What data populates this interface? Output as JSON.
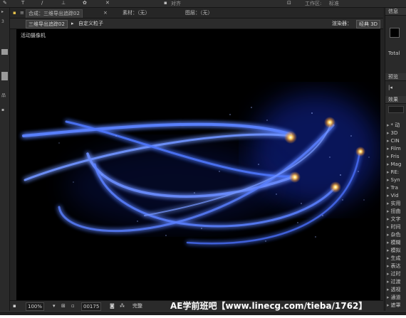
{
  "topbar": {
    "workspace_label": "工作区:",
    "workspace_value": "标准",
    "align_label": "对齐"
  },
  "tabs": [
    {
      "label": "合成：三维导出追踪02",
      "active": true
    },
    {
      "label": "素材：（无）",
      "active": false
    },
    {
      "label": "图层：（无）",
      "active": false
    }
  ],
  "subtabs": {
    "comp_chip": "三维导出追踪02",
    "custom_particle": "自定义粒子",
    "renderer_label": "渲染器：",
    "renderer_value": "经典 3D"
  },
  "viewer": {
    "camera_label": "活动摄像机",
    "background": "#000000",
    "glow_color": "#3a63ff",
    "streak_color": "#6f93ff"
  },
  "bottombar": {
    "zoom": "100%",
    "timecode": "00175",
    "quality": "完整",
    "watermark": "AE学前班吧【www.linecg.com/tieba/1762】"
  },
  "right_panel": {
    "info_header": "信息",
    "total_label": "Total",
    "preview_header": "预览",
    "effects_header": "效果",
    "effects": [
      {
        "label": "* 动"
      },
      {
        "label": "3D"
      },
      {
        "label": "CIN"
      },
      {
        "label": "Film"
      },
      {
        "label": "Fris"
      },
      {
        "label": "Mag"
      },
      {
        "label": "RE:"
      },
      {
        "label": "Syn"
      },
      {
        "label": "Tra"
      },
      {
        "label": "Vid"
      },
      {
        "label": "实用"
      },
      {
        "label": "扭曲"
      },
      {
        "label": "文字"
      },
      {
        "label": "时间"
      },
      {
        "label": "杂色"
      },
      {
        "label": "模糊"
      },
      {
        "label": "模拟"
      },
      {
        "label": "生成"
      },
      {
        "label": "表达"
      },
      {
        "label": "过时"
      },
      {
        "label": "过渡"
      },
      {
        "label": "透视"
      },
      {
        "label": "通道"
      },
      {
        "label": "遮罩"
      }
    ]
  }
}
